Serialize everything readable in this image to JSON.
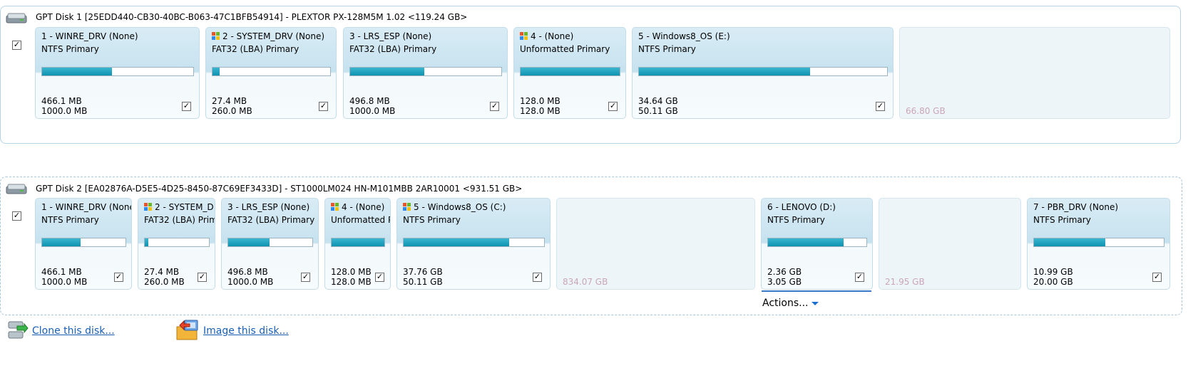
{
  "disk1": {
    "title": "GPT Disk 1 [25EDD440-CB30-40BC-B063-47C1BFB54914] - PLEXTOR PX-128M5M 1.02  <119.24 GB>",
    "checked": "✓",
    "partitions": [
      {
        "title": "1 - WINRE_DRV (None)",
        "type": "NTFS Primary",
        "used": "466.1 MB",
        "total": "1000.0 MB",
        "fill": 0.46,
        "check": "✓"
      },
      {
        "title": "2 - SYSTEM_DRV (None)",
        "type": "FAT32 (LBA) Primary",
        "used": "27.4 MB",
        "total": "260.0 MB",
        "fill": 0.06,
        "check": "✓"
      },
      {
        "title": "3 - LRS_ESP (None)",
        "type": "FAT32 (LBA) Primary",
        "used": "496.8 MB",
        "total": "1000.0 MB",
        "fill": 0.49,
        "check": "✓"
      },
      {
        "title": "4 -  (None)",
        "type": "Unformatted Primary",
        "used": "128.0 MB",
        "total": "128.0 MB",
        "fill": 1.0,
        "check": "✓"
      },
      {
        "title": "5 - Windows8_OS (E:)",
        "type": "NTFS Primary",
        "used": "34.64 GB",
        "total": "50.11 GB",
        "fill": 0.69,
        "check": "✓"
      }
    ],
    "unallocated": "66.80 GB"
  },
  "disk2": {
    "title": "GPT Disk 2 [EA02876A-D5E5-4D25-8450-87C69EF3433D] - ST1000LM024 HN-M101MBB 2AR10001  <931.51 GB>",
    "checked": "✓",
    "partitions": [
      {
        "title": "1 - WINRE_DRV (None",
        "type": "NTFS Primary",
        "used": "466.1 MB",
        "total": "1000.0 MB",
        "fill": 0.46,
        "check": "✓"
      },
      {
        "title": "2 - SYSTEM_D",
        "type": "FAT32 (LBA) Prim",
        "used": "27.4 MB",
        "total": "260.0 MB",
        "fill": 0.06,
        "check": "✓"
      },
      {
        "title": "3 - LRS_ESP (None)",
        "type": "FAT32 (LBA) Primary",
        "used": "496.8 MB",
        "total": "1000.0 MB",
        "fill": 0.49,
        "check": "✓"
      },
      {
        "title": "4 -  (None)",
        "type": "Unformatted Pr",
        "used": "128.0 MB",
        "total": "128.0 MB",
        "fill": 1.0,
        "check": "✓"
      },
      {
        "title": "5 - Windows8_OS (C:)",
        "type": "NTFS Primary",
        "used": "37.76 GB",
        "total": "50.11 GB",
        "fill": 0.75,
        "check": "✓"
      },
      {
        "title": "6 - LENOVO (D:)",
        "type": "NTFS Primary",
        "used": "2.36 GB",
        "total": "3.05 GB",
        "fill": 0.77,
        "check": "✓"
      },
      {
        "title": "7 - PBR_DRV (None)",
        "type": "NTFS Primary",
        "used": "10.99 GB",
        "total": "20.00 GB",
        "fill": 0.55,
        "check": "✓"
      }
    ],
    "unallocated": [
      "834.07 GB",
      "21.95 GB"
    ]
  },
  "actions_label": "Actions...",
  "clone_link": "Clone this disk...",
  "image_link": "Image this disk...",
  "colors": {
    "bar_fill": "#1aa0bd",
    "link": "#1a5fb4",
    "free_text": "#c9a6b9",
    "border": "#b7d4e6"
  },
  "icons": {
    "disk": "hard-disk-icon",
    "windows": "windows-logo-icon",
    "clone": "clone-disk-icon",
    "image": "image-disk-icon"
  }
}
